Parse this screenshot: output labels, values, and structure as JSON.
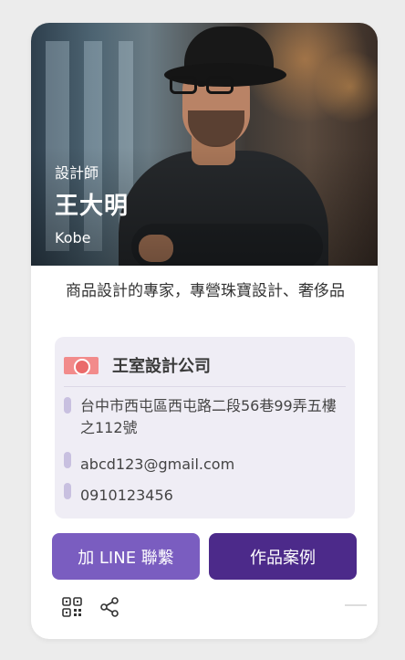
{
  "profile": {
    "role": "設計師",
    "name": "王大明",
    "english_name": "Kobe",
    "tagline": "商品設計的專家，專營珠寶設計、奢侈品"
  },
  "company": {
    "name": "王室設計公司",
    "address": "台中市西屯區西屯路二段56巷99弄五樓之112號",
    "email": "abcd123@gmail.com",
    "phone": "0910123456"
  },
  "actions": {
    "line_label": "加 LINE 聯繫",
    "works_label": "作品案例"
  },
  "icons": {
    "qr": "qr-code-icon",
    "share": "share-icon"
  },
  "colors": {
    "primary_button": "#7a5dc0",
    "secondary_button": "#4c2a8a",
    "info_background": "#efedf5",
    "bullet": "#c8c0e0",
    "logo": "#f28b8b"
  }
}
